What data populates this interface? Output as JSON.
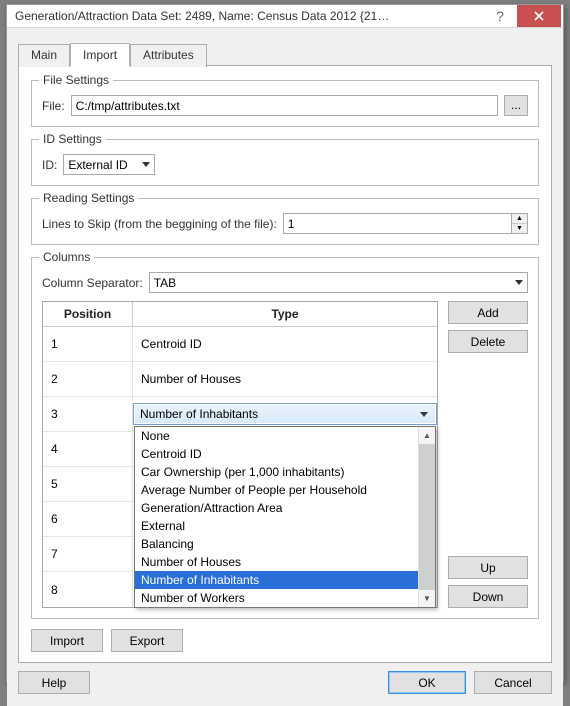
{
  "window": {
    "title": "Generation/Attraction Data Set: 2489, Name: Census Data 2012  {21…"
  },
  "tabs": {
    "main": "Main",
    "import": "Import",
    "attributes": "Attributes"
  },
  "fileSettings": {
    "legend": "File Settings",
    "fileLabel": "File:",
    "path": "C:/tmp/attributes.txt",
    "browse": "..."
  },
  "idSettings": {
    "legend": "ID Settings",
    "idLabel": "ID:",
    "value": "External ID"
  },
  "readingSettings": {
    "legend": "Reading Settings",
    "linesLabel": "Lines to Skip (from the beggining of the file):",
    "value": "1"
  },
  "columns": {
    "legend": "Columns",
    "sepLabel": "Column Separator:",
    "sepValue": "TAB",
    "headers": {
      "position": "Position",
      "type": "Type"
    },
    "rows": [
      {
        "pos": "1",
        "type": "Centroid ID"
      },
      {
        "pos": "2",
        "type": "Number of Houses"
      },
      {
        "pos": "3",
        "type": "Number of Inhabitants"
      },
      {
        "pos": "4",
        "type": ""
      },
      {
        "pos": "5",
        "type": ""
      },
      {
        "pos": "6",
        "type": ""
      },
      {
        "pos": "7",
        "type": ""
      },
      {
        "pos": "8",
        "type": ""
      }
    ],
    "dropdown": {
      "options": [
        "None",
        "Centroid ID",
        "Car Ownership (per 1,000 inhabitants)",
        "Average Number of People per Household",
        "Generation/Attraction Area",
        "External",
        "Balancing",
        "Number of Houses",
        "Number of Inhabitants",
        "Number of Workers"
      ],
      "selected": "Number of Inhabitants"
    },
    "buttons": {
      "add": "Add",
      "delete": "Delete",
      "up": "Up",
      "down": "Down"
    }
  },
  "actions": {
    "import": "Import",
    "export": "Export"
  },
  "footer": {
    "help": "Help",
    "ok": "OK",
    "cancel": "Cancel"
  }
}
